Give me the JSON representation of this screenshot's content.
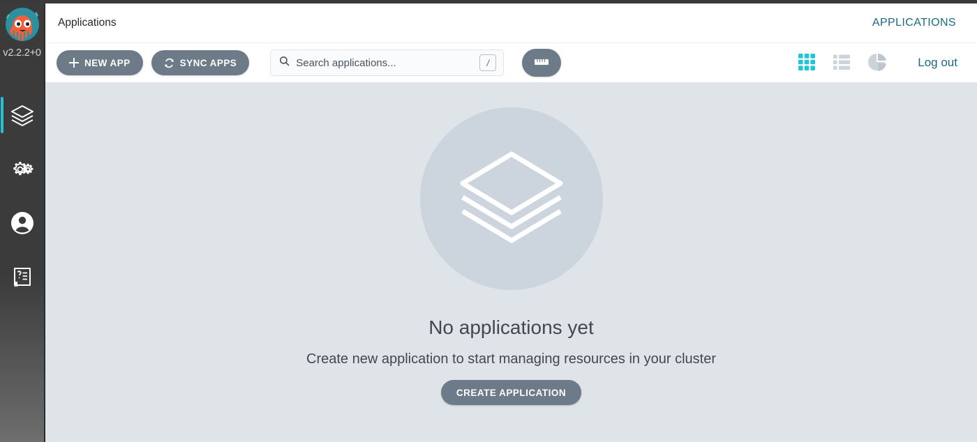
{
  "app": {
    "logo_icon": "argo-octopus-logo",
    "version": "v2.2.2+0"
  },
  "sidebar": {
    "items": [
      {
        "name": "applications",
        "icon": "layers-icon",
        "active": true
      },
      {
        "name": "settings",
        "icon": "gears-icon",
        "active": false
      },
      {
        "name": "user-info",
        "icon": "user-circle-icon",
        "active": false
      },
      {
        "name": "documentation",
        "icon": "help-book-icon",
        "active": false
      }
    ]
  },
  "header": {
    "breadcrumb": "Applications",
    "title": "APPLICATIONS"
  },
  "toolbar": {
    "new_app_label": "NEW APP",
    "new_app_icon": "plus-icon",
    "sync_apps_label": "SYNC APPS",
    "sync_apps_icon": "refresh-icon",
    "search": {
      "placeholder": "Search applications...",
      "value": "",
      "icon": "search-icon",
      "shortcut_key": "/"
    },
    "filter_button_icon": "ruler-filter-icon",
    "views": [
      {
        "name": "tiles-view",
        "icon": "grid-icon",
        "active": true
      },
      {
        "name": "list-view",
        "icon": "list-icon",
        "active": false
      },
      {
        "name": "summary-view",
        "icon": "pie-chart-icon",
        "active": false
      }
    ],
    "logout_label": "Log out"
  },
  "empty_state": {
    "icon": "layers-icon",
    "title": "No applications yet",
    "subtitle": "Create new application to start managing resources in your cluster",
    "cta_label": "CREATE APPLICATION"
  },
  "colors": {
    "accent_teal": "#25c4d4",
    "link_teal": "#1a6a84",
    "button_grey": "#6d7b88",
    "page_background": "#dee4e8",
    "sidebar_dark": "#3b3b3b"
  }
}
